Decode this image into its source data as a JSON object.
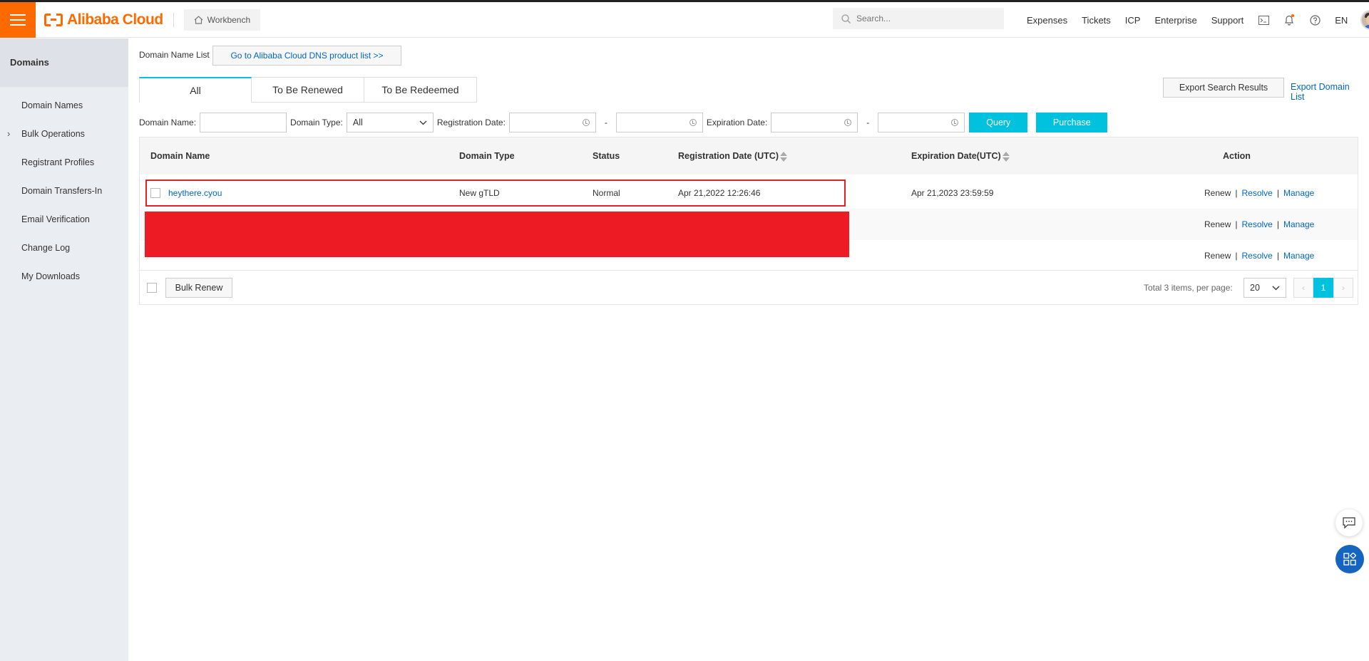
{
  "topbar": {
    "logo_text": "Alibaba Cloud",
    "workbench_label": "Workbench",
    "search_placeholder": "Search...",
    "nav_links": [
      "Expenses",
      "Tickets",
      "ICP",
      "Enterprise",
      "Support"
    ],
    "language": "EN",
    "icons": [
      "terminal-icon",
      "bell-icon",
      "help-icon"
    ]
  },
  "sidebar": {
    "title": "Domains",
    "items": [
      {
        "label": "Domain Names"
      },
      {
        "label": "Bulk Operations"
      },
      {
        "label": "Registrant Profiles"
      },
      {
        "label": "Domain Transfers-In"
      },
      {
        "label": "Email Verification"
      },
      {
        "label": "Change Log"
      },
      {
        "label": "My Downloads"
      }
    ]
  },
  "main": {
    "list_label": "Domain Name List",
    "dns_button": "Go to Alibaba Cloud DNS product list >>",
    "tabs": [
      {
        "label": "All",
        "active": true
      },
      {
        "label": "To Be Renewed"
      },
      {
        "label": "To Be Redeemed"
      }
    ],
    "export_button": "Export Search Results",
    "export_link": "Export Domain List",
    "filters": {
      "domain_name_label": "Domain Name:",
      "domain_type_label": "Domain Type:",
      "domain_type_value": "All",
      "registration_date_label": "Registration Date:",
      "expiration_date_label": "Expiration Date:",
      "dash": "-",
      "query_button": "Query",
      "purchase_button": "Purchase"
    },
    "table": {
      "headers": {
        "domain_name": "Domain Name",
        "domain_type": "Domain Type",
        "status": "Status",
        "registration_date": "Registration Date (UTC)",
        "expiration_date": "Expiration Date(UTC)",
        "action": "Action"
      },
      "rows": [
        {
          "domain": "heythere.cyou",
          "type": "New gTLD",
          "status": "Normal",
          "registration": "Apr 21,2022 12:26:46",
          "expiration": "Apr 21,2023 23:59:59"
        }
      ],
      "actions": {
        "renew": "Renew",
        "resolve": "Resolve",
        "manage": "Manage",
        "separator": "|"
      }
    },
    "footer": {
      "bulk_renew": "Bulk Renew",
      "total": "Total 3 items,  per page:",
      "per_page": "20",
      "current_page": "1"
    }
  },
  "colors": {
    "brand": "#ff6a00",
    "primary": "#00c1de",
    "link": "#0066cc",
    "highlight": "#e61e26"
  }
}
